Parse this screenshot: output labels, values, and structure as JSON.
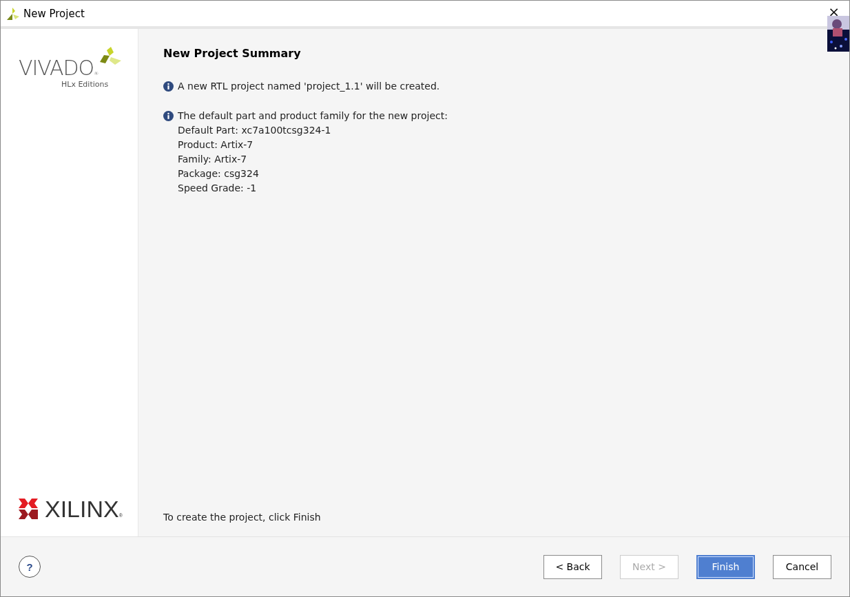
{
  "window": {
    "title": "New Project",
    "close": "×"
  },
  "sidebar": {
    "product_logo": {
      "name": "VIVADO$_{®}$",
      "subtitle": "HLx Editions"
    },
    "company_logo": {
      "name": "XILINX$_{®}$"
    }
  },
  "page": {
    "title": "New Project Summary",
    "messages": [
      {
        "kind": "info",
        "text": "A new RTL project named 'project_1.1' will be created."
      },
      {
        "kind": "info",
        "text": "The default part and product family for the new project:",
        "details": [
          "Default Part: xc7a100tcsg324-1",
          "Product: Artix-7",
          "Family: Artix-7",
          "Package: csg324",
          "Speed Grade: -1"
        ]
      }
    ],
    "footer_note": "To create the project, click Finish"
  },
  "help": {
    "label": "?"
  },
  "buttons": [
    {
      "label": "< Back",
      "disabled": false,
      "default": false
    },
    {
      "label": "Next >",
      "disabled": true,
      "default": false
    },
    {
      "label": "Finish",
      "disabled": false,
      "default": true
    },
    {
      "label": "Cancel",
      "disabled": false,
      "default": false
    }
  ]
}
